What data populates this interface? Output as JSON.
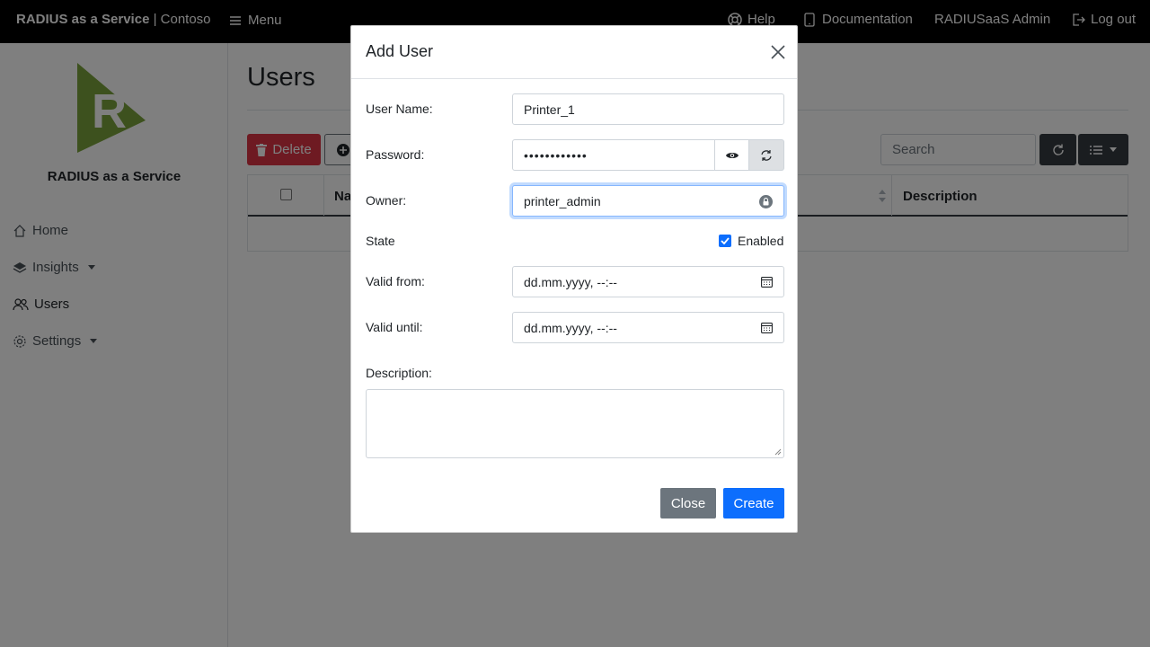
{
  "navbar": {
    "brand_bold": "RADIUS as a Service",
    "brand_rest": " | Contoso",
    "menu_label": "Menu",
    "help_label": "Help",
    "documentation_label": "Documentation",
    "admin_label": "RADIUSaaS Admin",
    "logout_label": "Log out"
  },
  "sidebar": {
    "brand_name": "RADIUS as a Service",
    "items": [
      {
        "label": "Home",
        "icon": "home-icon"
      },
      {
        "label": "Insights",
        "icon": "layers-icon"
      },
      {
        "label": "Users",
        "icon": "users-icon"
      },
      {
        "label": "Settings",
        "icon": "gear-icon"
      }
    ]
  },
  "main": {
    "title": "Users",
    "delete_label": "Delete",
    "search_placeholder": "Search",
    "columns": [
      "Na",
      "Description"
    ]
  },
  "modal": {
    "title": "Add User",
    "fields": {
      "user_name_label": "User Name:",
      "user_name_value": "Printer_1",
      "password_label": "Password:",
      "password_value": "••••••••••••",
      "owner_label": "Owner:",
      "owner_value": "printer_admin",
      "state_label": "State",
      "state_checkbox_label": "Enabled",
      "valid_from_label": "Valid from:",
      "valid_from_value": "dd.mm.yyyy, --:--",
      "valid_until_label": "Valid until:",
      "valid_until_value": "dd.mm.yyyy, --:--",
      "description_label": "Description:"
    },
    "close_label": "Close",
    "create_label": "Create"
  },
  "colors": {
    "primary": "#0d6efd",
    "danger": "#dc3545",
    "secondary": "#6c757d",
    "dark": "#343a40",
    "logo_green": "#7ba33c"
  }
}
